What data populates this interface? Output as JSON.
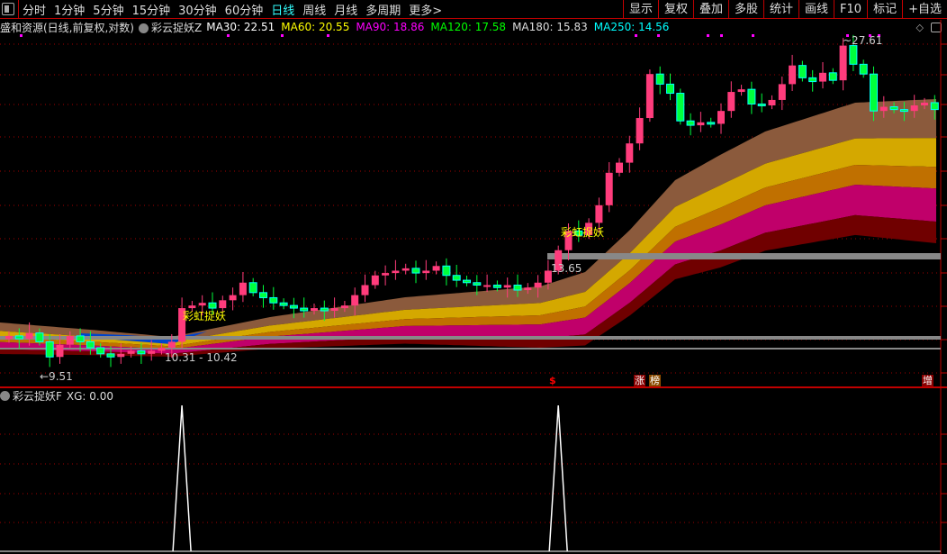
{
  "topbar": {
    "periods": [
      "分时",
      "1分钟",
      "5分钟",
      "15分钟",
      "30分钟",
      "60分钟",
      "日线",
      "周线",
      "月线",
      "多周期",
      "更多>"
    ],
    "active_period": "日线",
    "tools": [
      "显示",
      "复权",
      "叠加",
      "多股",
      "统计",
      "画线",
      "F10",
      "标记",
      "+自选"
    ]
  },
  "legend": {
    "title": "盛和资源(日线,前复权,对数)",
    "indicator": "彩云捉妖Z",
    "ma": [
      {
        "label": "MA30: 22.51",
        "color": "#ffffff"
      },
      {
        "label": "MA60: 20.55",
        "color": "#ffff00"
      },
      {
        "label": "MA90: 18.86",
        "color": "#ff00ff"
      },
      {
        "label": "MA120: 17.58",
        "color": "#00ff00"
      },
      {
        "label": "MA180: 15.83",
        "color": "#dddddd"
      },
      {
        "label": "MA250: 14.56",
        "color": "#00ffff"
      }
    ]
  },
  "annotations": {
    "signal1": "彩虹捉妖",
    "signal2": "彩虹捉妖",
    "level": "13.65",
    "range": "10.31 - 10.42",
    "low": "←9.51",
    "high": "~27.61",
    "mark_s": "$",
    "mark_zhang": "涨",
    "mark_bang": "榜",
    "mark_zeng": "增"
  },
  "lower": {
    "indicator": "彩云捉妖F",
    "value": "XG: 0.00"
  },
  "colors": {
    "up": "#ff3c7c",
    "down": "#00ff3c",
    "grid": "#a00000"
  },
  "chart_data": {
    "type": "candlestick",
    "price_scale": "log",
    "high": 27.61,
    "low": 9.51,
    "closes": [
      10.6,
      10.5,
      10.7,
      10.4,
      9.9,
      10.3,
      10.6,
      10.4,
      10.2,
      10.0,
      9.9,
      10.0,
      10.1,
      10.0,
      10.1,
      10.2,
      10.4,
      11.6,
      11.7,
      11.8,
      11.6,
      11.9,
      12.1,
      12.6,
      12.2,
      12.0,
      11.8,
      11.7,
      11.6,
      11.5,
      11.6,
      11.5,
      11.6,
      11.7,
      12.1,
      12.5,
      12.9,
      13.0,
      13.1,
      13.2,
      13.0,
      13.1,
      13.3,
      12.9,
      12.7,
      12.6,
      12.5,
      12.5,
      12.4,
      12.5,
      12.3,
      12.4,
      12.6,
      13.1,
      14.0,
      14.9,
      14.7,
      15.3,
      16.2,
      18.0,
      18.6,
      19.8,
      21.5,
      24.8,
      24.0,
      23.3,
      21.3,
      21.0,
      21.2,
      21.1,
      22.0,
      23.4,
      23.6,
      22.5,
      22.4,
      22.8,
      24.0,
      25.5,
      24.5,
      24.2,
      24.9,
      24.3,
      27.2,
      25.6,
      24.8,
      22.0,
      22.3,
      22.1,
      22.0,
      22.4,
      22.6,
      22.1
    ],
    "xg_signals": [
      17,
      54
    ]
  }
}
